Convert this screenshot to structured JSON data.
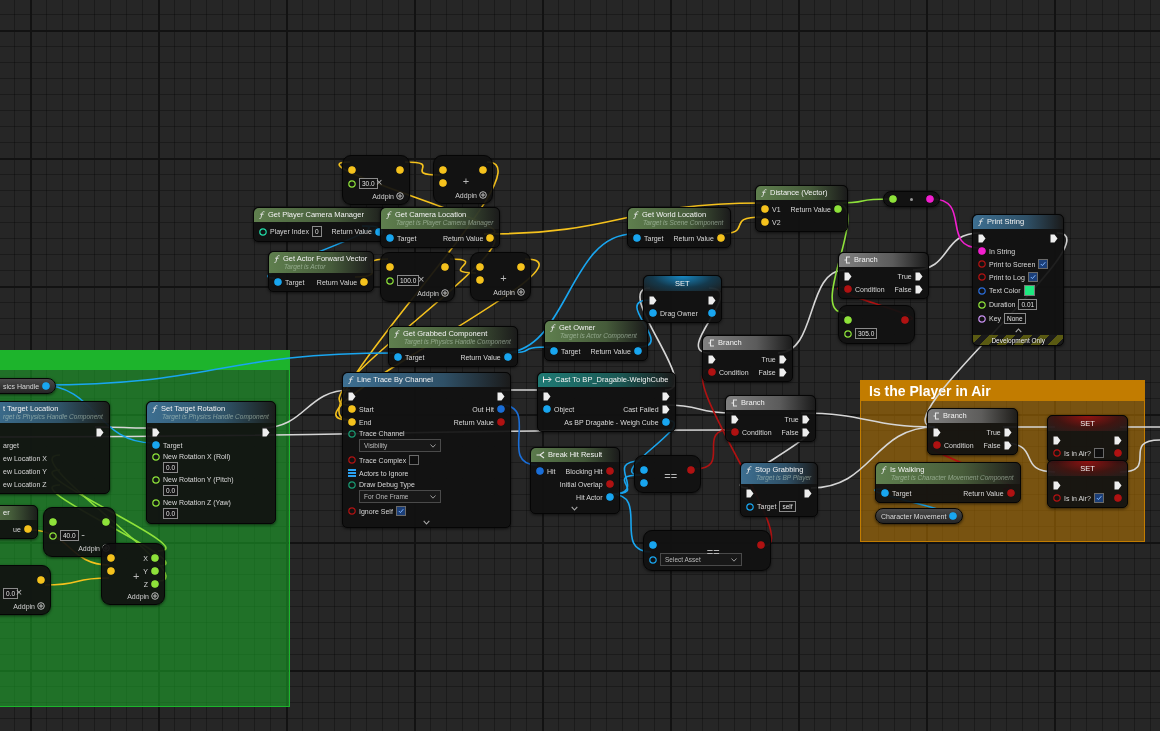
{
  "comments": [
    {
      "color": "#1db42c"
    },
    {
      "title": "Is the Player in Air",
      "color": "#c27c00"
    }
  ],
  "nodes": [
    {
      "kind": "operator",
      "symbol": "×",
      "rows": [
        {
          "in": {
            "kind": "vector"
          },
          "out": {
            "kind": "vector"
          }
        },
        {
          "in": {
            "kind": "float",
            "value": "30.0"
          }
        }
      ],
      "addpin": "Addpin"
    },
    {
      "kind": "operator",
      "symbol": "+",
      "rows": [
        {
          "in": {
            "kind": "vector"
          },
          "out": {
            "kind": "vector"
          }
        },
        {
          "in": {
            "kind": "vector"
          }
        }
      ],
      "addpin": "Addpin"
    },
    {
      "kind": "pure_function",
      "title": "Get Player Camera Manager",
      "rows": [
        {
          "in": {
            "kind": "int",
            "label": "Player Index",
            "value": "0"
          },
          "out": {
            "kind": "object",
            "label": "Return Value"
          }
        }
      ]
    },
    {
      "kind": "pure_function",
      "title": "Get Camera Location",
      "subtitle": "Target is Player Camera Manager",
      "rows": [
        {
          "in": {
            "kind": "object",
            "label": "Target"
          },
          "out": {
            "kind": "vector",
            "label": "Return Value"
          }
        }
      ]
    },
    {
      "kind": "pure_function",
      "title": "Get World Location",
      "subtitle": "Target is Scene Component",
      "rows": [
        {
          "in": {
            "kind": "object",
            "label": "Target"
          },
          "out": {
            "kind": "vector",
            "label": "Return Value"
          }
        }
      ]
    },
    {
      "kind": "pure_function",
      "title": "Distance (Vector)",
      "rows": [
        {
          "in": {
            "kind": "vector",
            "label": "V1"
          },
          "out": {
            "kind": "float",
            "label": "Return Value"
          }
        },
        {
          "in": {
            "kind": "vector",
            "label": "V2"
          }
        }
      ]
    },
    {
      "kind": "convert",
      "rows": [
        {
          "in": {
            "kind": "float"
          },
          "out": {
            "kind": "string"
          }
        }
      ]
    },
    {
      "kind": "function",
      "title": "Print String",
      "rows": [
        {
          "in": {
            "kind": "exec"
          },
          "out": {
            "kind": "exec"
          }
        },
        {
          "in": {
            "kind": "string",
            "label": "In String"
          }
        },
        {
          "in": {
            "kind": "bool",
            "label": "Print to Screen",
            "checked": true
          }
        },
        {
          "in": {
            "kind": "bool",
            "label": "Print to Log",
            "checked": true
          }
        },
        {
          "in": {
            "kind": "color",
            "label": "Text Color",
            "color": "#1ee880"
          }
        },
        {
          "in": {
            "kind": "float",
            "label": "Duration",
            "value": "0.01"
          }
        },
        {
          "in": {
            "kind": "name",
            "label": "Key",
            "value": "None"
          }
        }
      ],
      "footer": "Development Only",
      "advanced_shown": true
    },
    {
      "kind": "pure_function",
      "title": "Get Actor Forward Vector",
      "subtitle": "Target is Actor",
      "rows": [
        {
          "in": {
            "kind": "object",
            "label": "Target"
          },
          "out": {
            "kind": "vector",
            "label": "Return Value"
          }
        }
      ]
    },
    {
      "kind": "operator",
      "symbol": "×",
      "rows": [
        {
          "in": {
            "kind": "vector"
          },
          "out": {
            "kind": "vector"
          }
        },
        {
          "in": {
            "kind": "float",
            "value": "100.0"
          }
        }
      ],
      "addpin": "Addpin"
    },
    {
      "kind": "operator",
      "symbol": "+",
      "rows": [
        {
          "in": {
            "kind": "vector"
          },
          "out": {
            "kind": "vector"
          }
        },
        {
          "in": {
            "kind": "vector"
          }
        }
      ],
      "addpin": "Addpin"
    },
    {
      "kind": "branch",
      "title": "Branch",
      "rows": [
        {
          "in": {
            "kind": "exec"
          },
          "out": {
            "kind": "exec",
            "label": "True"
          }
        },
        {
          "in": {
            "kind": "bool",
            "label": "Condition"
          },
          "out": {
            "kind": "exec",
            "label": "False"
          }
        }
      ]
    },
    {
      "kind": "set",
      "title": "SET",
      "rows": [
        {
          "in": {
            "kind": "exec"
          },
          "out": {
            "kind": "exec"
          }
        },
        {
          "in": {
            "kind": "object",
            "label": "Drag Owner"
          },
          "out": {
            "kind": "object"
          }
        }
      ]
    },
    {
      "kind": "operator",
      "rows": [
        {
          "in": {
            "kind": "float"
          },
          "out": {
            "kind": "bool"
          }
        },
        {
          "in": {
            "kind": "float",
            "value": "305.0"
          }
        }
      ]
    },
    {
      "kind": "pure_function",
      "title": "Get Grabbed Component",
      "subtitle": "Target is Physics Handle Component",
      "rows": [
        {
          "in": {
            "kind": "object",
            "label": "Target"
          },
          "out": {
            "kind": "object",
            "label": "Return Value"
          }
        }
      ]
    },
    {
      "kind": "pure_function",
      "title": "Get Owner",
      "subtitle": "Target is Actor Component",
      "rows": [
        {
          "in": {
            "kind": "object",
            "label": "Target"
          },
          "out": {
            "kind": "object",
            "label": "Return Value"
          }
        }
      ]
    },
    {
      "kind": "branch",
      "title": "Branch",
      "rows": [
        {
          "in": {
            "kind": "exec"
          },
          "out": {
            "kind": "exec",
            "label": "True"
          }
        },
        {
          "in": {
            "kind": "bool",
            "label": "Condition"
          },
          "out": {
            "kind": "exec",
            "label": "False"
          }
        }
      ]
    },
    {
      "kind": "variable",
      "rows": [
        {
          "out": {
            "kind": "object",
            "label": "sics Handle"
          }
        }
      ]
    },
    {
      "kind": "function",
      "title": "Line Trace By Channel",
      "rows": [
        {
          "in": {
            "kind": "exec"
          },
          "out": {
            "kind": "exec"
          }
        },
        {
          "in": {
            "kind": "vector",
            "label": "Start"
          },
          "out": {
            "kind": "struct",
            "label": "Out Hit"
          }
        },
        {
          "in": {
            "kind": "vector",
            "label": "End"
          },
          "out": {
            "kind": "bool",
            "label": "Return Value"
          }
        },
        {
          "in": {
            "kind": "enum",
            "label": "Trace Channel",
            "value": "Visibility"
          }
        },
        {
          "in": {
            "kind": "bool",
            "label": "Trace Complex",
            "checked": false
          }
        },
        {
          "in": {
            "kind": "array",
            "label": "Actors to Ignore"
          }
        },
        {
          "in": {
            "kind": "enum",
            "label": "Draw Debug Type",
            "value": "For One Frame"
          }
        },
        {
          "in": {
            "kind": "bool",
            "label": "Ignore Self",
            "checked": true
          }
        }
      ],
      "advanced_shown": false
    },
    {
      "kind": "cast",
      "title": "Cast To BP_Dragable-WeighCube",
      "rows": [
        {
          "in": {
            "kind": "exec"
          },
          "out": {
            "kind": "exec"
          }
        },
        {
          "in": {
            "kind": "object",
            "label": "Object"
          },
          "out": {
            "kind": "exec",
            "label": "Cast Failed"
          }
        },
        {
          "out": {
            "kind": "object",
            "label": "As BP Dragable - Weigh Cube"
          }
        }
      ]
    },
    {
      "kind": "branch",
      "title": "Branch",
      "rows": [
        {
          "in": {
            "kind": "exec"
          },
          "out": {
            "kind": "exec",
            "label": "True"
          }
        },
        {
          "in": {
            "kind": "bool",
            "label": "Condition"
          },
          "out": {
            "kind": "exec",
            "label": "False"
          }
        }
      ]
    },
    {
      "kind": "function",
      "title": "t Target Location",
      "subtitle": "rget is Physics Handle Component",
      "rows": [
        {
          "out": {
            "kind": "exec"
          }
        },
        {
          "in": {
            "label": "arget"
          }
        },
        {
          "in": {
            "label": "ew Location X"
          }
        },
        {
          "in": {
            "label": "ew Location Y"
          }
        },
        {
          "in": {
            "label": "ew Location Z"
          }
        }
      ]
    },
    {
      "kind": "function",
      "title": "Set Target Rotation",
      "subtitle": "Target is Physics Handle Component",
      "rows": [
        {
          "in": {
            "kind": "exec"
          },
          "out": {
            "kind": "exec"
          }
        },
        {
          "in": {
            "kind": "object",
            "label": "Target"
          }
        },
        {
          "in": {
            "kind": "float",
            "label": "New Rotation X (Roll)",
            "value": "0.0"
          }
        },
        {
          "in": {
            "kind": "float",
            "label": "New Rotation Y (Pitch)",
            "value": "0.0"
          }
        },
        {
          "in": {
            "kind": "float",
            "label": "New Rotation Z (Yaw)",
            "value": "0.0"
          }
        }
      ]
    },
    {
      "kind": "branch",
      "title": "Branch",
      "rows": [
        {
          "in": {
            "kind": "exec"
          },
          "out": {
            "kind": "exec",
            "label": "True"
          }
        },
        {
          "in": {
            "kind": "bool",
            "label": "Condition"
          },
          "out": {
            "kind": "exec",
            "label": "False"
          }
        }
      ]
    },
    {
      "kind": "set",
      "title": "SET",
      "rows": [
        {
          "in": {
            "kind": "exec"
          },
          "out": {
            "kind": "exec"
          }
        },
        {
          "in": {
            "kind": "bool",
            "label": "Is in Air?",
            "checked": false
          },
          "out": {
            "kind": "bool"
          }
        }
      ]
    },
    {
      "kind": "break",
      "title": "Break Hit Result",
      "rows": [
        {
          "in": {
            "kind": "struct",
            "label": "Hit"
          },
          "out": {
            "kind": "bool",
            "label": "Blocking Hit"
          }
        },
        {
          "out": {
            "kind": "bool",
            "label": "Initial Overlap"
          }
        },
        {
          "out": {
            "kind": "object",
            "label": "Hit Actor"
          }
        }
      ],
      "advanced_shown": false
    },
    {
      "kind": "operator",
      "symbol": "==",
      "rows": [
        {
          "in": {
            "kind": "object"
          },
          "out": {
            "kind": "bool"
          }
        },
        {
          "in": {
            "kind": "object"
          }
        }
      ]
    },
    {
      "kind": "function",
      "title": "Stop Grabbing",
      "subtitle": "Target is BP Player",
      "rows": [
        {
          "in": {
            "kind": "exec"
          },
          "out": {
            "kind": "exec"
          }
        },
        {
          "in": {
            "kind": "object",
            "label": "Target",
            "value": "self"
          }
        }
      ]
    },
    {
      "kind": "pure_function",
      "title": "Is Walking",
      "subtitle": "Target is Character Movement Component",
      "rows": [
        {
          "in": {
            "kind": "object",
            "label": "Target"
          },
          "out": {
            "kind": "bool",
            "label": "Return Value"
          }
        }
      ]
    },
    {
      "kind": "set",
      "title": "SET",
      "rows": [
        {
          "in": {
            "kind": "exec"
          },
          "out": {
            "kind": "exec"
          }
        },
        {
          "in": {
            "kind": "bool",
            "label": "Is in Air?",
            "checked": true
          },
          "out": {
            "kind": "bool"
          }
        }
      ]
    },
    {
      "kind": "pure_function",
      "title": "er",
      "rows": [
        {
          "out": {
            "kind": "vector",
            "label": "ue"
          }
        }
      ]
    },
    {
      "kind": "operator",
      "symbol": "-",
      "rows": [
        {
          "in": {
            "kind": "float"
          },
          "out": {
            "kind": "float"
          }
        },
        {
          "in": {
            "kind": "float",
            "value": "40.0"
          }
        }
      ],
      "addpin": "Addpin"
    },
    {
      "kind": "variable",
      "rows": [
        {
          "out": {
            "kind": "object",
            "label": "Character Movement"
          }
        }
      ]
    },
    {
      "kind": "operator",
      "symbol": "==",
      "rows": [
        {
          "in": {
            "kind": "object"
          },
          "out": {
            "kind": "bool"
          }
        },
        {
          "in": {
            "kind": "asset",
            "value": "Select Asset"
          }
        }
      ]
    },
    {
      "kind": "operator",
      "symbol": "+",
      "rows": [
        {
          "in": {
            "kind": "vector"
          },
          "out": {
            "kind": "float",
            "label": "X"
          }
        },
        {
          "in": {
            "kind": "vector"
          },
          "out": {
            "kind": "float",
            "label": "Y"
          }
        },
        {
          "out": {
            "kind": "float",
            "label": "Z"
          }
        }
      ],
      "addpin": "Addpin"
    },
    {
      "kind": "operator",
      "symbol": "×",
      "rows": [
        {
          "out": {
            "kind": "vector"
          }
        },
        {
          "in": {
            "value": "0.0"
          }
        }
      ],
      "addpin": "Addpin"
    }
  ]
}
